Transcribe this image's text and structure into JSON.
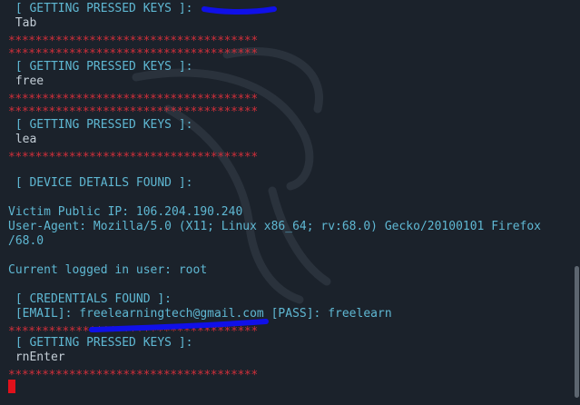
{
  "terminal": {
    "lines": [
      {
        "kind": "cyan",
        "text": " [ GETTING PRESSED KEYS ]:"
      },
      {
        "kind": "plain",
        "text": " Tab"
      },
      {
        "kind": "red",
        "text": "*************************************"
      },
      {
        "kind": "red",
        "text": "*************************************"
      },
      {
        "kind": "cyan",
        "text": " [ GETTING PRESSED KEYS ]:"
      },
      {
        "kind": "plain",
        "text": " free"
      },
      {
        "kind": "red",
        "text": "*************************************"
      },
      {
        "kind": "red",
        "text": "*************************************"
      },
      {
        "kind": "cyan",
        "text": " [ GETTING PRESSED KEYS ]:"
      },
      {
        "kind": "plain",
        "text": " lea"
      },
      {
        "kind": "red",
        "text": "*************************************"
      },
      {
        "kind": "cyan",
        "text": " [ DEVICE DETAILS FOUND ]:"
      },
      {
        "kind": "cyan",
        "text": "Victim Public IP: 106.204.190.240"
      },
      {
        "kind": "cyan",
        "text": "User-Agent: Mozilla/5.0 (X11; Linux x86_64; rv:68.0) Gecko/20100101 Firefox"
      },
      {
        "kind": "cyan",
        "text": "/68.0"
      },
      {
        "kind": "cyan",
        "text": "Current logged in user: root"
      },
      {
        "kind": "cyan",
        "text": " [ CREDENTIALS FOUND ]:"
      },
      {
        "kind": "cyan",
        "text": " [EMAIL]: freelearningtech@gmail.com [PASS]: freelearn"
      },
      {
        "kind": "red",
        "text": "*************************************"
      },
      {
        "kind": "cyan",
        "text": " [ GETTING PRESSED KEYS ]:"
      },
      {
        "kind": "plain",
        "text": " rnEnter"
      },
      {
        "kind": "red",
        "text": "*************************************"
      }
    ]
  },
  "colors": {
    "background": "#1b222b",
    "cyan": "#5fb8d3",
    "red": "#d12f3a",
    "redaction": "#1010e8",
    "cursor": "#e0111b"
  },
  "icons": {
    "background_logo": "kali-dragon-icon",
    "cursor": "block-cursor-icon"
  }
}
